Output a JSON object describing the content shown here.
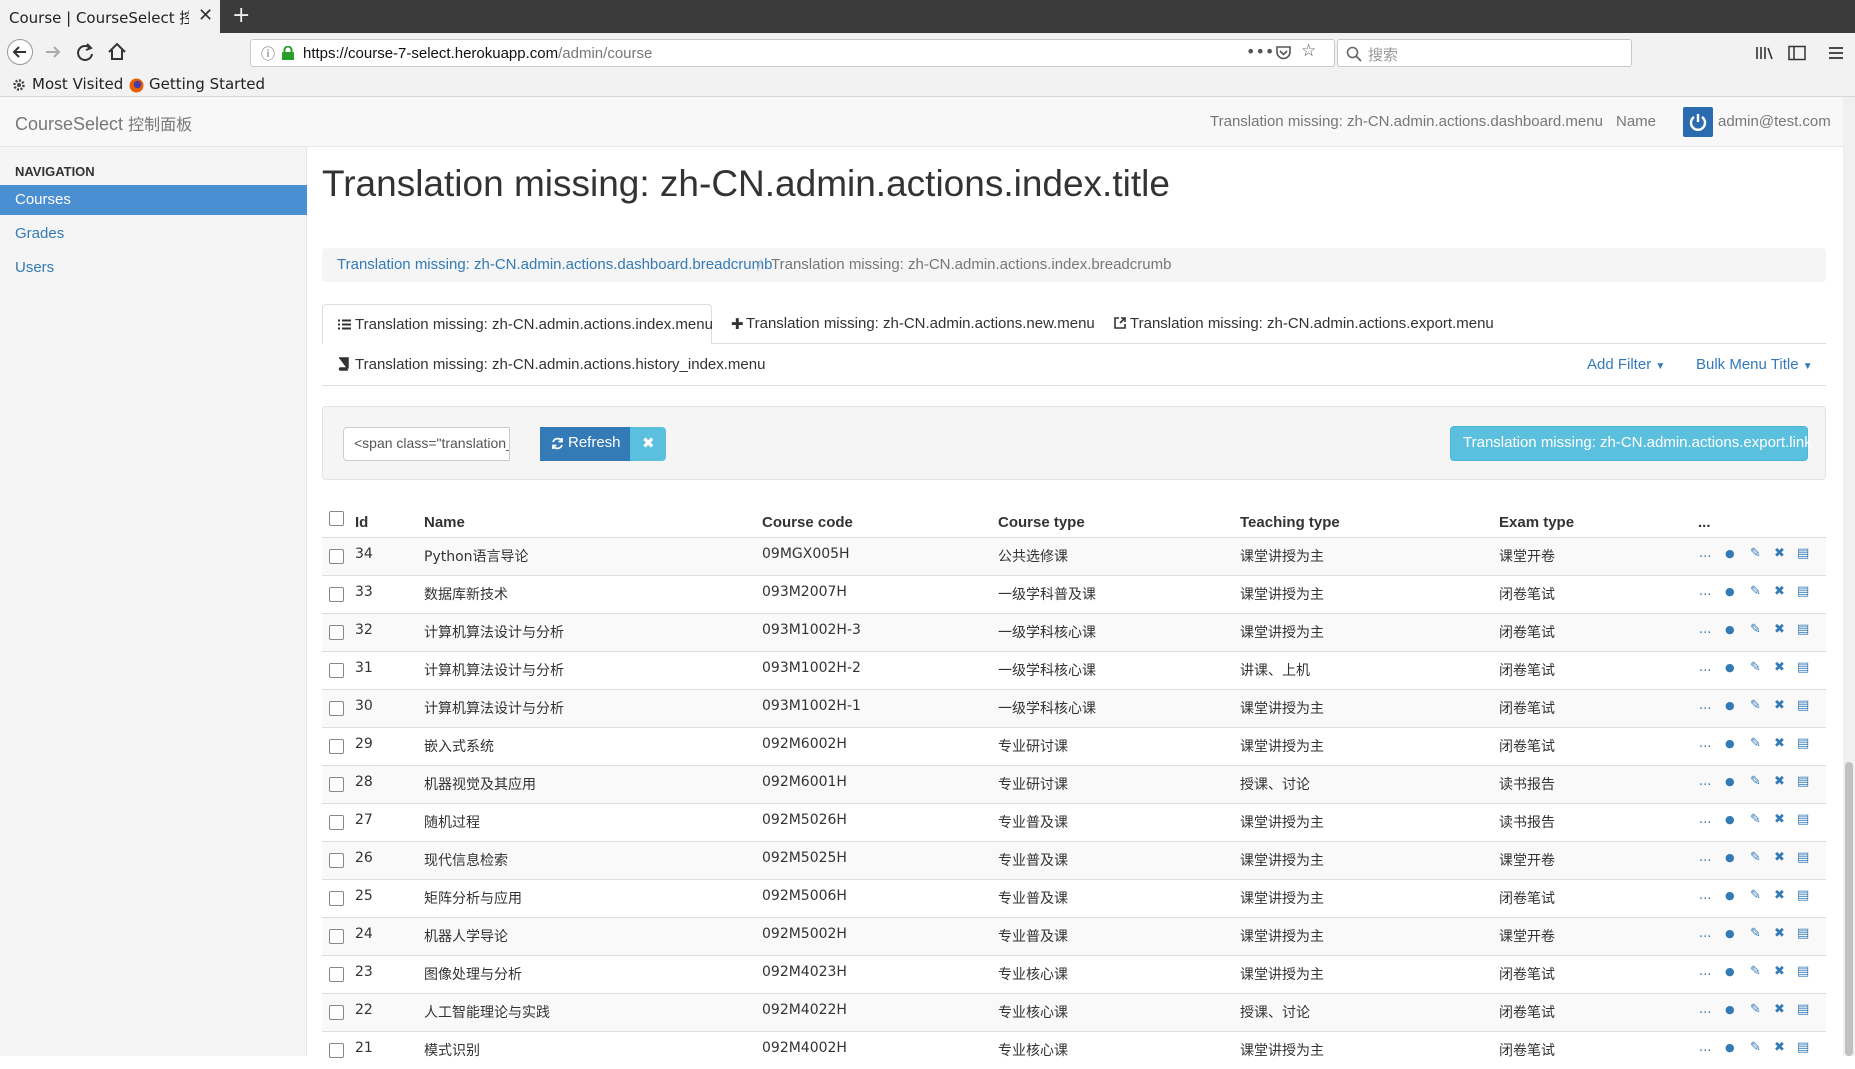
{
  "browser": {
    "tab_title": "Course | CourseSelect 控制面",
    "tab_close": "✕",
    "new_tab": "+",
    "url_host": "https://course-7-select.herokuapp.com",
    "url_path": "/admin/course",
    "search_placeholder": "搜索",
    "bookmarks": [
      "Most Visited",
      "Getting Started"
    ]
  },
  "header": {
    "brand": "CourseSelect",
    "brand_cn": "控制面板",
    "dashboard_menu": "Translation missing: zh-CN.admin.actions.dashboard.menu",
    "name": "Name",
    "user": "admin@test.com"
  },
  "sidebar": {
    "title": "NAVIGATION",
    "items": [
      {
        "label": "Courses",
        "active": true
      },
      {
        "label": "Grades",
        "active": false
      },
      {
        "label": "Users",
        "active": false
      }
    ]
  },
  "main": {
    "title": "Translation missing: zh-CN.admin.actions.index.title",
    "breadcrumb": [
      "Translation missing: zh-CN.admin.actions.dashboard.breadcrumb",
      "Translation missing: zh-CN.admin.actions.index.breadcrumb"
    ],
    "breadcrumb_sep": "/",
    "tabs": {
      "index": "Translation missing: zh-CN.admin.actions.index.menu",
      "new": "Translation missing: zh-CN.admin.actions.new.menu",
      "export": "Translation missing: zh-CN.admin.actions.export.menu",
      "history": "Translation missing: zh-CN.admin.actions.history_index.menu"
    },
    "add_filter": "Add Filter",
    "bulk_menu": "Bulk Menu Title",
    "query_value": "<span class=\"translation_m",
    "refresh": "Refresh",
    "export_link": "Translation missing: zh-CN.admin.actions.export.link"
  },
  "table": {
    "headers": {
      "id": "Id",
      "name": "Name",
      "code": "Course code",
      "course_type": "Course type",
      "teaching_type": "Teaching type",
      "exam_type": "Exam type",
      "actions": "..."
    },
    "rows": [
      {
        "id": "34",
        "name": "Python语言导论",
        "code": "09MGX005H",
        "course_type": "公共选修课",
        "teaching_type": "课堂讲授为主",
        "exam_type": "课堂开卷"
      },
      {
        "id": "33",
        "name": "数据库新技术",
        "code": "093M2007H",
        "course_type": "一级学科普及课",
        "teaching_type": "课堂讲授为主",
        "exam_type": "闭卷笔试"
      },
      {
        "id": "32",
        "name": "计算机算法设计与分析",
        "code": "093M1002H-3",
        "course_type": "一级学科核心课",
        "teaching_type": "课堂讲授为主",
        "exam_type": "闭卷笔试"
      },
      {
        "id": "31",
        "name": "计算机算法设计与分析",
        "code": "093M1002H-2",
        "course_type": "一级学科核心课",
        "teaching_type": "讲课、上机",
        "exam_type": "闭卷笔试"
      },
      {
        "id": "30",
        "name": "计算机算法设计与分析",
        "code": "093M1002H-1",
        "course_type": "一级学科核心课",
        "teaching_type": "课堂讲授为主",
        "exam_type": "闭卷笔试"
      },
      {
        "id": "29",
        "name": "嵌入式系统",
        "code": "092M6002H",
        "course_type": "专业研讨课",
        "teaching_type": "课堂讲授为主",
        "exam_type": "闭卷笔试"
      },
      {
        "id": "28",
        "name": "机器视觉及其应用",
        "code": "092M6001H",
        "course_type": "专业研讨课",
        "teaching_type": "授课、讨论",
        "exam_type": "读书报告"
      },
      {
        "id": "27",
        "name": "随机过程",
        "code": "092M5026H",
        "course_type": "专业普及课",
        "teaching_type": "课堂讲授为主",
        "exam_type": "读书报告"
      },
      {
        "id": "26",
        "name": "现代信息检索",
        "code": "092M5025H",
        "course_type": "专业普及课",
        "teaching_type": "课堂讲授为主",
        "exam_type": "课堂开卷"
      },
      {
        "id": "25",
        "name": "矩阵分析与应用",
        "code": "092M5006H",
        "course_type": "专业普及课",
        "teaching_type": "课堂讲授为主",
        "exam_type": "闭卷笔试"
      },
      {
        "id": "24",
        "name": "机器人学导论",
        "code": "092M5002H",
        "course_type": "专业普及课",
        "teaching_type": "课堂讲授为主",
        "exam_type": "课堂开卷"
      },
      {
        "id": "23",
        "name": "图像处理与分析",
        "code": "092M4023H",
        "course_type": "专业核心课",
        "teaching_type": "课堂讲授为主",
        "exam_type": "闭卷笔试"
      },
      {
        "id": "22",
        "name": "人工智能理论与实践",
        "code": "092M4022H",
        "course_type": "专业核心课",
        "teaching_type": "授课、讨论",
        "exam_type": "闭卷笔试"
      },
      {
        "id": "21",
        "name": "模式识别",
        "code": "092M4002H",
        "course_type": "专业核心课",
        "teaching_type": "课堂讲授为主",
        "exam_type": "闭卷笔试"
      }
    ],
    "row_actions": [
      "...",
      "info-icon",
      "pencil-icon",
      "delete-icon",
      "history-icon"
    ]
  },
  "colors": {
    "accent": "#337ab7",
    "active_nav": "#4a8fd1",
    "info": "#5bc0de"
  }
}
